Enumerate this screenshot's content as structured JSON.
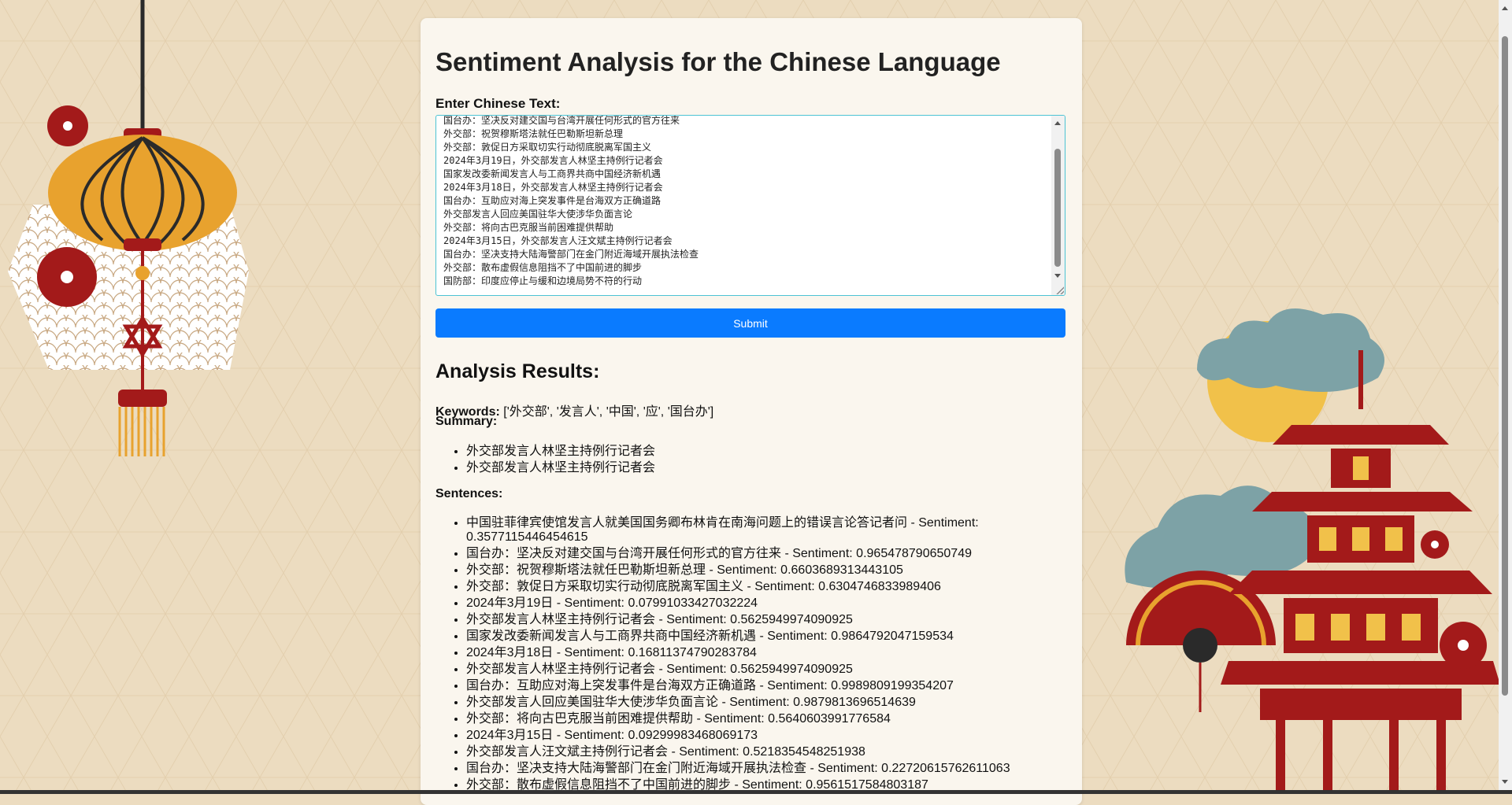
{
  "page": {
    "title": "Sentiment Analysis for the Chinese Language",
    "input_label": "Enter Chinese Text:",
    "submit_label": "Submit",
    "results_title": "Analysis Results:"
  },
  "textarea": {
    "lines": [
      "国台办：坚决反对建交国与台湾开展任何形式的官方往来",
      "外交部：祝贺穆斯塔法就任巴勒斯坦新总理",
      "外交部：敦促日方采取切实行动彻底脱离军国主义",
      "2024年3月19日，外交部发言人林坚主持例行记者会",
      "国家发改委新闻发言人与工商界共商中国经济新机遇",
      "2024年3月18日，外交部发言人林坚主持例行记者会",
      "国台办：互助应对海上突发事件是台海双方正确道路",
      "外交部发言人回应美国驻华大使涉华负面言论",
      "外交部：将向古巴克服当前困难提供帮助",
      "2024年3月15日，外交部发言人汪文斌主持例行记者会",
      "国台办：坚决支持大陆海警部门在金门附近海域开展执法检查",
      "外交部：散布虚假信息阻挡不了中国前进的脚步",
      "国防部：印度应停止与缓和边境局势不符的行动"
    ]
  },
  "keywords": {
    "label": "Keywords:",
    "value": "['外交部', '发言人', '中国', '应', '国台办']"
  },
  "summary": {
    "label": "Summary:",
    "items": [
      "外交部发言人林坚主持例行记者会",
      "外交部发言人林坚主持例行记者会"
    ]
  },
  "sentences": {
    "label": "Sentences:",
    "sentiment_word": "Sentiment:",
    "items": [
      {
        "text": "中国驻菲律宾使馆发言人就美国国务卿布林肯在南海问题上的错误言论答记者问",
        "score": "0.3577115446454615"
      },
      {
        "text": "国台办：坚决反对建交国与台湾开展任何形式的官方往来",
        "score": "0.965478790650749"
      },
      {
        "text": "外交部：祝贺穆斯塔法就任巴勒斯坦新总理",
        "score": "0.6603689313443105"
      },
      {
        "text": "外交部：敦促日方采取切实行动彻底脱离军国主义",
        "score": "0.6304746833989406"
      },
      {
        "text": "2024年3月19日",
        "score": "0.07991033427032224"
      },
      {
        "text": "外交部发言人林坚主持例行记者会",
        "score": "0.5625949974090925"
      },
      {
        "text": "国家发改委新闻发言人与工商界共商中国经济新机遇",
        "score": "0.9864792047159534"
      },
      {
        "text": "2024年3月18日",
        "score": "0.16811374790283784"
      },
      {
        "text": "外交部发言人林坚主持例行记者会",
        "score": "0.5625949974090925"
      },
      {
        "text": "国台办：互助应对海上突发事件是台海双方正确道路",
        "score": "0.9989809199354207"
      },
      {
        "text": "外交部发言人回应美国驻华大使涉华负面言论",
        "score": "0.9879813696514639"
      },
      {
        "text": "外交部：将向古巴克服当前困难提供帮助",
        "score": "0.5640603991776584"
      },
      {
        "text": "2024年3月15日",
        "score": "0.09299983468069173"
      },
      {
        "text": "外交部发言人汪文斌主持例行记者会",
        "score": "0.5218354548251938"
      },
      {
        "text": "国台办：坚决支持大陆海警部门在金门附近海域开展执法检查",
        "score": "0.22720615762611063"
      },
      {
        "text": "外交部：散布虚假信息阻挡不了中国前进的脚步",
        "score": "0.9561517584803187"
      }
    ]
  },
  "colors": {
    "background": "#ecdcc0",
    "accent": "#0a7bff",
    "lantern_gold": "#e8a22e",
    "red": "#a31a1a",
    "cloud": "#7da2a6",
    "sun": "#f1c14a"
  }
}
